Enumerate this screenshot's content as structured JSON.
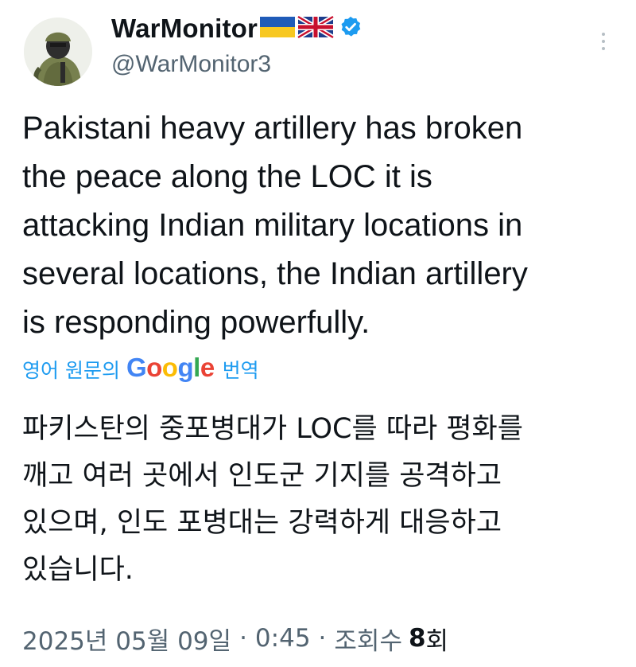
{
  "user": {
    "display_name": "WarMonitor",
    "flags": [
      "ukraine-flag",
      "uk-flag"
    ],
    "handle": "@WarMonitor3",
    "verified": true
  },
  "tweet": {
    "text": "Pakistani heavy artillery has broken\nthe peace along the LOC it is\nattacking Indian military locations in\nseveral locations, the Indian artillery\nis responding powerfully."
  },
  "translation": {
    "prefix": "영어 원문의",
    "google_letters": [
      "G",
      "o",
      "o",
      "g",
      "l",
      "e"
    ],
    "suffix": "번역",
    "text": "파키스탄의 중포병대가 LOC를 따라 평화를\n깨고 여러 곳에서 인도군 기지를 공격하고\n있으며, 인도 포병대는 강력하게 대응하고\n있습니다."
  },
  "meta": {
    "date": "2025년 05월 09일",
    "time": "0:45",
    "views_label": "조회수",
    "views_count": "8",
    "views_suffix": "회",
    "separator": "·"
  },
  "colors": {
    "link": "#1d9bf0",
    "secondary_text": "#536471",
    "verified": "#1d9bf0"
  }
}
